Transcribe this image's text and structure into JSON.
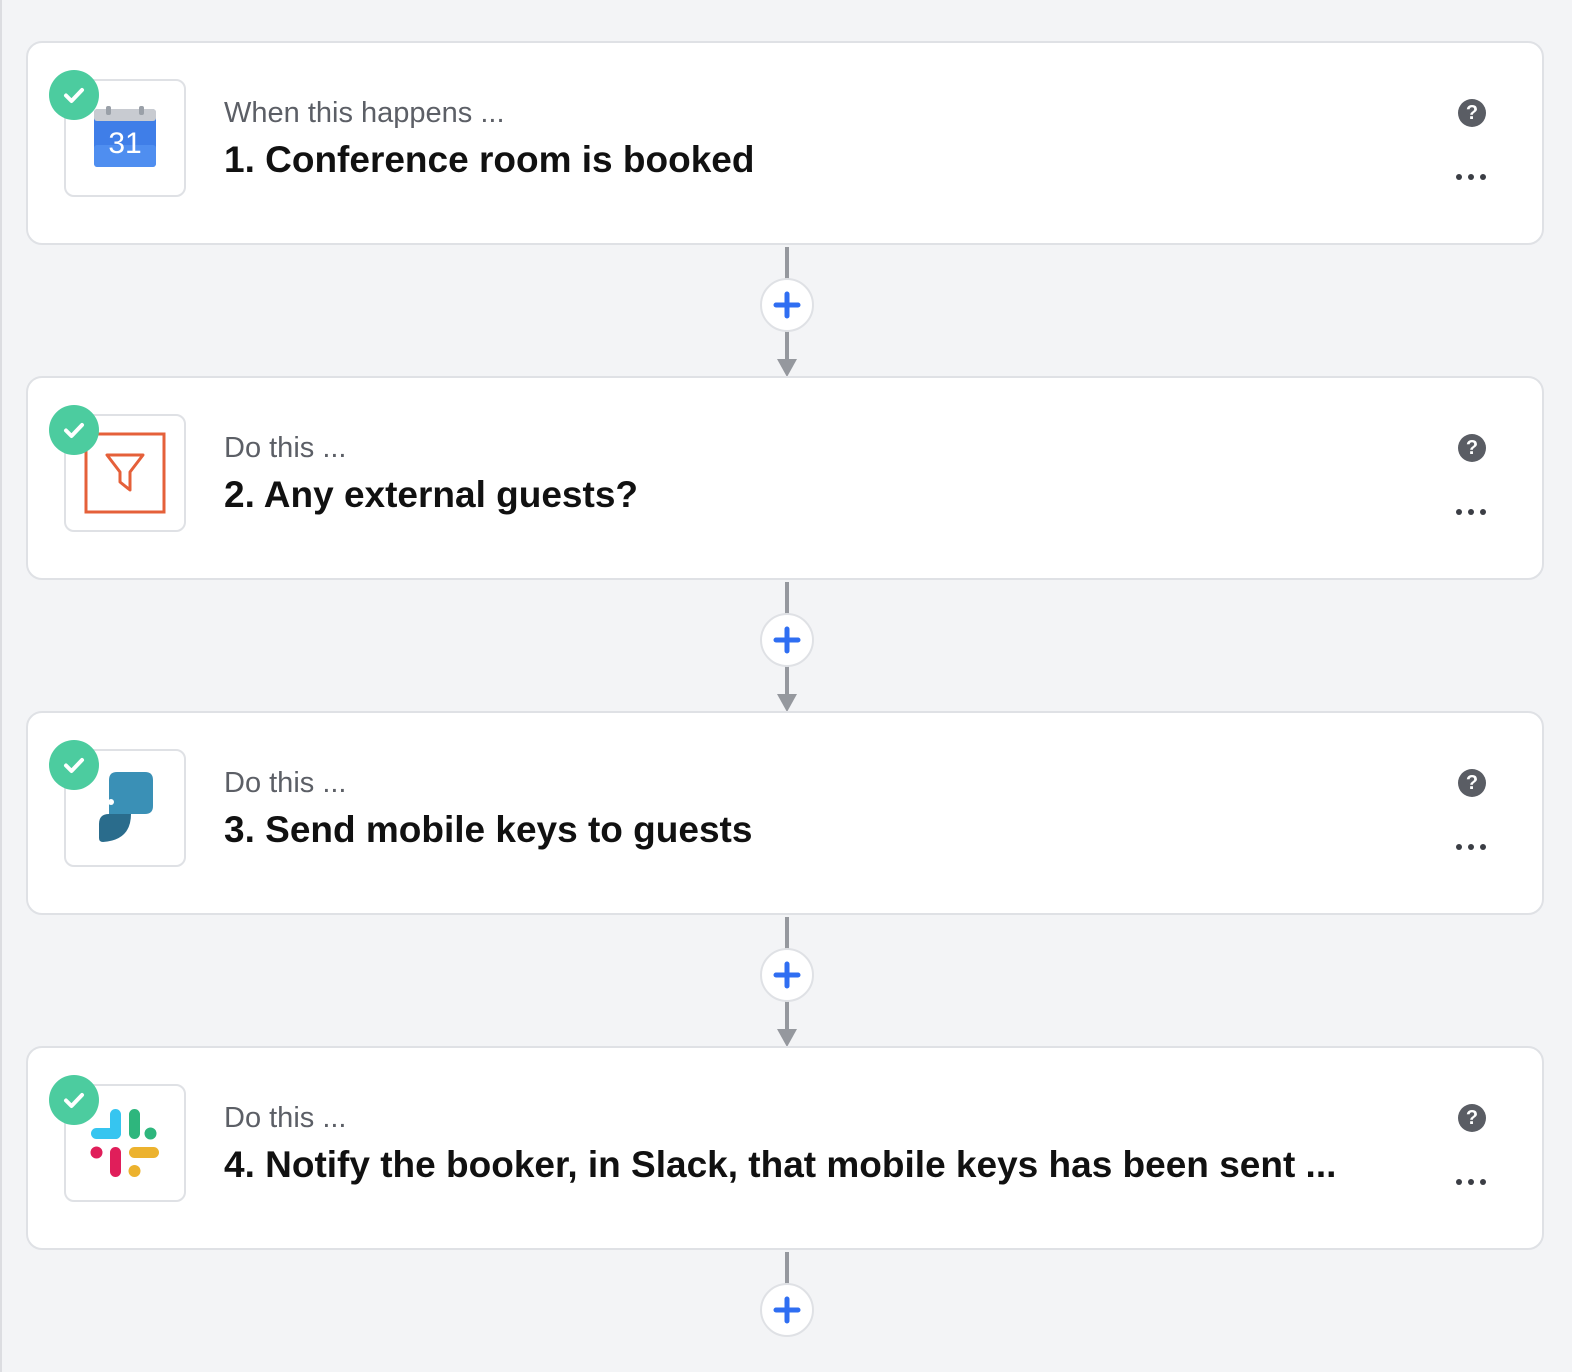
{
  "steps": [
    {
      "kicker": "When this happens ...",
      "title": "1. Conference room is booked",
      "app_icon": "google-calendar-icon",
      "calendar_day": "31",
      "status": "complete"
    },
    {
      "kicker": "Do this ...",
      "title": "2. Any external guests?",
      "app_icon": "filter-icon",
      "status": "complete"
    },
    {
      "kicker": "Do this ...",
      "title": "3. Send mobile keys to guests",
      "app_icon": "parakey-icon",
      "status": "complete"
    },
    {
      "kicker": "Do this ...",
      "title": "4. Notify the booker, in Slack, that mobile keys has been sent ...",
      "app_icon": "slack-icon",
      "status": "complete"
    }
  ],
  "help_label": "?",
  "colors": {
    "check": "#4ccc9f",
    "add": "#2f6ef2",
    "connector": "#95989e",
    "filter": "#e5603a",
    "calendar": "#4a86e8"
  }
}
